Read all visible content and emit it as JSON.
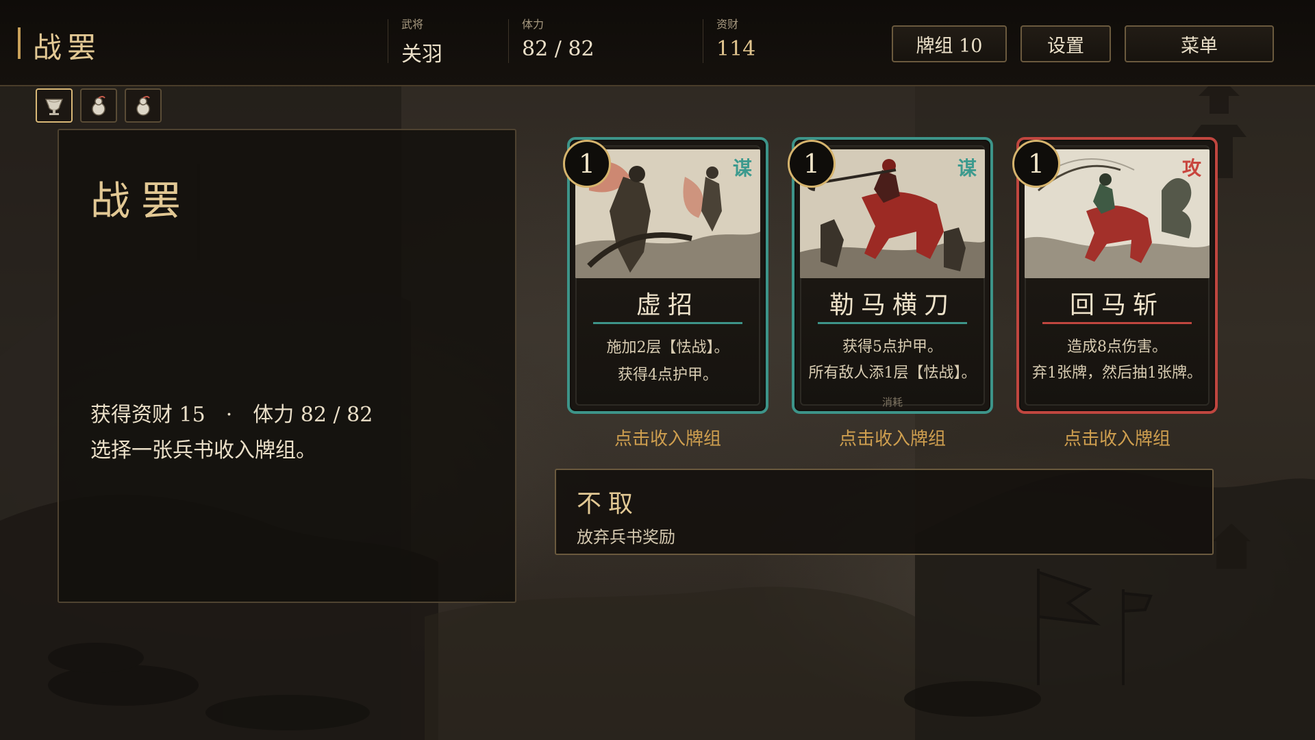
{
  "header": {
    "title": "战罢",
    "stats": [
      {
        "label": "武将",
        "value": "关羽"
      },
      {
        "label": "体力",
        "value": "82 / 82"
      },
      {
        "label": "资财",
        "value": "114"
      }
    ],
    "buttons": {
      "deck": "牌组 10",
      "settings": "设置",
      "menu": "菜单"
    }
  },
  "items": [
    {
      "icon": "wine-cup-icon",
      "selected": true
    },
    {
      "icon": "medicine-gourd-icon",
      "selected": false
    },
    {
      "icon": "medicine-gourd-icon",
      "selected": false
    }
  ],
  "panel": {
    "title": "战罢",
    "reward_gold": "获得资财 15",
    "separator": "·",
    "reward_hp": "体力 82 / 82",
    "prompt": "选择一张兵书收入牌组。"
  },
  "cards": [
    {
      "cost": "1",
      "type": "谋",
      "name": "虚招",
      "desc": [
        "施加2层【怯战】。",
        "获得4点护甲。"
      ],
      "tag": "",
      "pick": "点击收入牌组",
      "color": "#3d9489"
    },
    {
      "cost": "1",
      "type": "谋",
      "name": "勒马横刀",
      "desc": [
        "获得5点护甲。",
        "所有敌人添1层【怯战】。"
      ],
      "tag": "消耗",
      "pick": "点击收入牌组",
      "color": "#3d9489"
    },
    {
      "cost": "1",
      "type": "攻",
      "name": "回马斩",
      "desc": [
        "造成8点伤害。",
        "弃1张牌，然后抽1张牌。"
      ],
      "tag": "",
      "pick": "点击收入牌组",
      "color": "#c0463f"
    }
  ],
  "skip": {
    "title": "不取",
    "subtitle": "放弃兵书奖励"
  }
}
